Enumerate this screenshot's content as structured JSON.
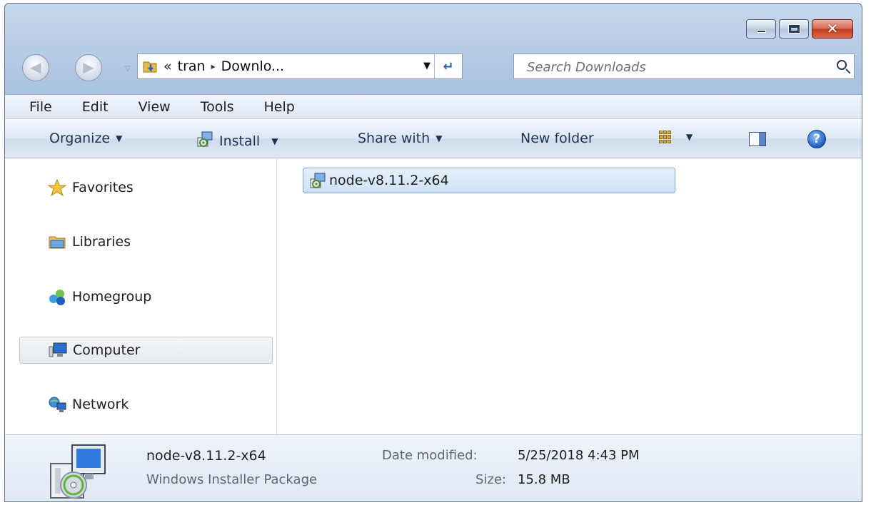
{
  "window": {
    "caption": {
      "minimize": "minimize",
      "maximize": "maximize",
      "close": "✕"
    }
  },
  "address": {
    "overflow_glyph": "«",
    "crumbs": [
      "tran",
      "Downlo..."
    ],
    "separator": "▸"
  },
  "search": {
    "placeholder": "Search Downloads"
  },
  "menu": {
    "items": [
      "File",
      "Edit",
      "View",
      "Tools",
      "Help"
    ]
  },
  "toolbar": {
    "organize": "Organize",
    "install": "Install",
    "share_with": "Share with",
    "new_folder": "New folder",
    "help": "?"
  },
  "sidebar": {
    "items": [
      {
        "label": "Favorites",
        "icon": "star-icon"
      },
      {
        "label": "Libraries",
        "icon": "library-icon"
      },
      {
        "label": "Homegroup",
        "icon": "homegroup-icon"
      },
      {
        "label": "Computer",
        "icon": "computer-icon",
        "selected": true
      },
      {
        "label": "Network",
        "icon": "network-icon"
      }
    ]
  },
  "files": [
    {
      "name": "node-v8.11.2-x64",
      "icon": "msi-package-icon",
      "selected": true
    }
  ],
  "details": {
    "name": "node-v8.11.2-x64",
    "type": "Windows Installer Package",
    "date_label": "Date modified:",
    "date_value": "5/25/2018 4:43 PM",
    "size_label": "Size:",
    "size_value": "15.8 MB"
  },
  "colors": {
    "chrome": "#b8cde6",
    "selection": "#cfe2f7",
    "selection_border": "#7da2ce",
    "close_button": "#c23a1f"
  }
}
